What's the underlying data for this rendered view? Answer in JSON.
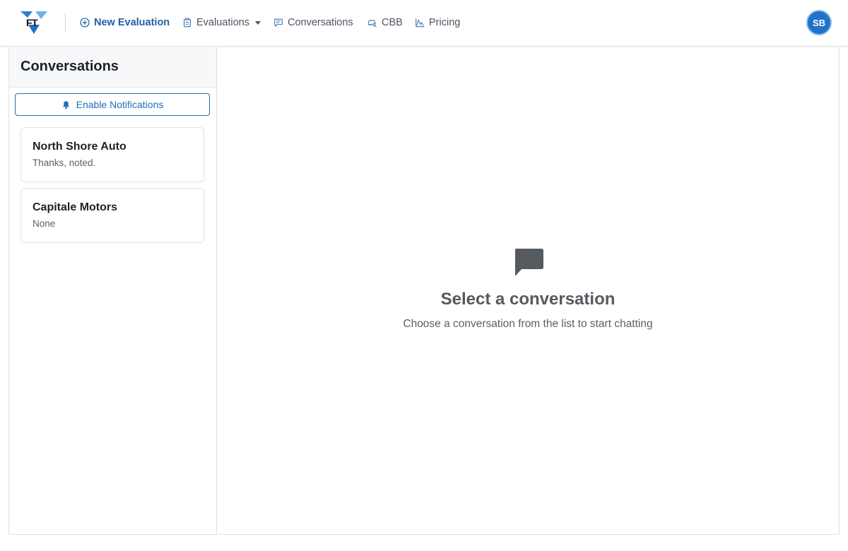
{
  "nav": {
    "logo_text": "FT",
    "new_evaluation": "New Evaluation",
    "evaluations": "Evaluations",
    "conversations": "Conversations",
    "cbb": "CBB",
    "pricing": "Pricing",
    "avatar_initials": "SB",
    "icons": {
      "new_evaluation": "plus-circle-icon",
      "evaluations": "clipboard-icon",
      "conversations": "chat-square-icon",
      "cbb": "car-search-icon",
      "pricing": "chart-line-icon"
    }
  },
  "sidebar": {
    "title": "Conversations",
    "notify_label": "Enable Notifications",
    "notify_icon": "bell-icon",
    "conversations": [
      {
        "name": "North Shore Auto",
        "preview": "Thanks, noted."
      },
      {
        "name": "Capitale Motors",
        "preview": "None"
      }
    ]
  },
  "main": {
    "empty_icon": "chat-bubble-icon",
    "empty_title": "Select a conversation",
    "empty_subtitle": "Choose a conversation from the list to start chatting"
  },
  "colors": {
    "brand_blue": "#1f5fa6",
    "accent_blue": "#1f6fb8",
    "avatar_bg": "#1f73c9",
    "icon_gray": "#555a5f"
  }
}
